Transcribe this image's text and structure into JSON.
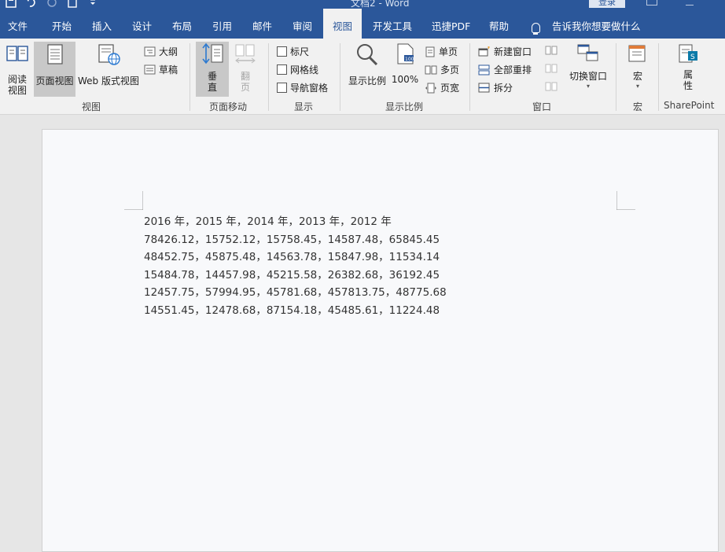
{
  "window": {
    "title": "文档2 - Word",
    "login_label": "登录"
  },
  "tabs": [
    {
      "label": "文件"
    },
    {
      "label": "开始"
    },
    {
      "label": "插入"
    },
    {
      "label": "设计"
    },
    {
      "label": "布局"
    },
    {
      "label": "引用"
    },
    {
      "label": "邮件"
    },
    {
      "label": "审阅"
    },
    {
      "label": "视图"
    },
    {
      "label": "开发工具"
    },
    {
      "label": "迅捷PDF"
    },
    {
      "label": "帮助"
    }
  ],
  "tell_me": "告诉我你想要做什么",
  "ribbon": {
    "views": {
      "group": "视图",
      "read_mode": [
        "阅读",
        "视图"
      ],
      "print_layout": "页面视图",
      "web_layout": "Web 版式视图",
      "outline": "大纲",
      "draft": "草稿"
    },
    "page_movement": {
      "group": "页面移动",
      "vertical": [
        "垂",
        "直"
      ],
      "side_to_side": [
        "翻",
        "页"
      ]
    },
    "show": {
      "group": "显示",
      "ruler": "标尺",
      "gridlines": "网格线",
      "nav_pane": "导航窗格"
    },
    "zoom": {
      "group": "显示比例",
      "zoom": "显示比例",
      "hundred": "100%",
      "one_page": "单页",
      "multi_page": "多页",
      "page_width": "页宽"
    },
    "window": {
      "group": "窗口",
      "new_window": "新建窗口",
      "arrange_all": "全部重排",
      "split": "拆分",
      "switch_windows": "切换窗口"
    },
    "macros": {
      "group": "宏",
      "macros": "宏"
    },
    "sharepoint": {
      "group": "SharePoint",
      "properties": [
        "属",
        "性"
      ]
    }
  },
  "document": {
    "lines": [
      "2016 年，2015 年，2014 年，2013 年，2012 年",
      "78426.12，15752.12，15758.45，14587.48，65845.45",
      "48452.75，45875.48，14563.78，15847.98，11534.14",
      "15484.78，14457.98，45215.58，26382.68，36192.45",
      "12457.75，57994.95，45781.68，457813.75，48775.68",
      "14551.45，12478.68，87154.18，45485.61，11224.48"
    ]
  },
  "colors": {
    "brand": "#2b579a",
    "ribbon_bg": "#f1f1f1",
    "selected": "#c8c8c8"
  }
}
